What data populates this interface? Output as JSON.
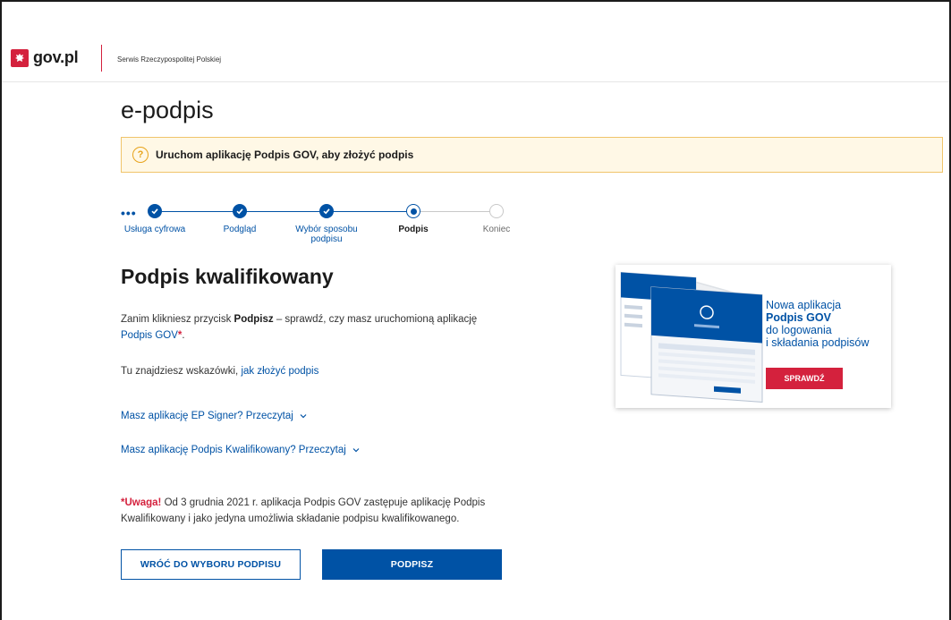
{
  "header": {
    "logo_text": "gov.pl",
    "service_name": "Serwis Rzeczypospolitej Polskiej"
  },
  "page": {
    "title": "e-podpis"
  },
  "alert": {
    "icon": "question-icon",
    "text": "Uruchom aplikację Podpis GOV, aby złożyć podpis"
  },
  "stepper": {
    "steps": [
      {
        "label": "Usługa cyfrowa",
        "state": "done"
      },
      {
        "label": "Podgląd",
        "state": "done"
      },
      {
        "label": "Wybór sposobu podpisu",
        "state": "done"
      },
      {
        "label": "Podpis",
        "state": "current"
      },
      {
        "label": "Koniec",
        "state": "todo"
      }
    ]
  },
  "content": {
    "heading": "Podpis kwalifikowany",
    "intro_before": "Zanim klikniesz przycisk ",
    "intro_bold": "Podpisz",
    "intro_after": " – sprawdź, czy masz uruchomioną aplikację",
    "intro_link": "Podpis GOV",
    "intro_star": "*",
    "intro_end": ".",
    "hint_text": "Tu znajdziesz wskazówki, ",
    "hint_link": "jak złożyć podpis",
    "expander_1": "Masz aplikację EP Signer? Przeczytaj",
    "expander_2": "Masz aplikację Podpis Kwalifikowany? Przeczytaj",
    "warning_label": "*Uwaga!",
    "warning_text": " Od 3 grudnia 2021 r. aplikacja Podpis GOV zastępuje aplikację Podpis Kwalifikowany i jako jedyna umożliwia składanie podpisu kwalifikowanego."
  },
  "buttons": {
    "back_label": "WRÓĆ DO WYBORU PODPISU",
    "sign_label": "PODPISZ"
  },
  "promo": {
    "line1": "Nowa aplikacja",
    "line2": "Podpis GOV",
    "line3": "do logowania",
    "line4": "i składania podpisów",
    "button_label": "SPRAWDŹ"
  },
  "colors": {
    "primary": "#0052a5",
    "accent_red": "#d4213d",
    "alert_border": "#f0c46a"
  }
}
